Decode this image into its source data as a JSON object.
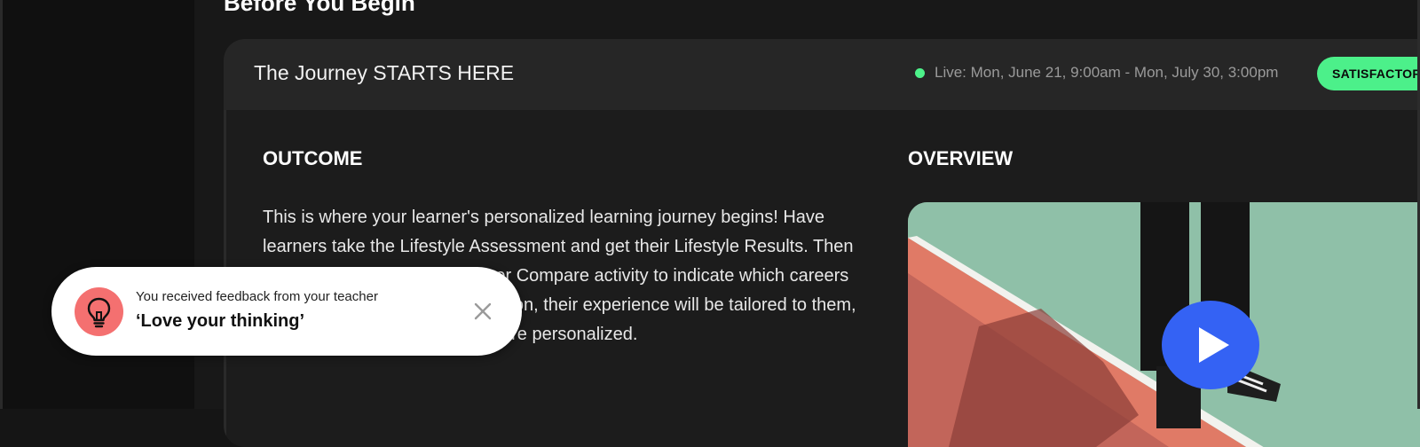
{
  "page": {
    "section_heading": "Before You Begin"
  },
  "card": {
    "title": "The Journey STARTS HERE",
    "live_text": "Live: Mon, June 21, 9:00am - Mon, July 30, 3:00pm",
    "status_badge": "SATISFACTOR"
  },
  "outcome": {
    "heading": "OUTCOME",
    "text": "This is where your learner's personalized learning journey begins! Have learners take the Lifestyle Assessment and get their Lifestyle Results. Then have them complete the Career Compare activity to indicate which careers they're interested in. From here on, their experience will be tailored to them, making it more relevant and more personalized."
  },
  "overview": {
    "heading": "OVERVIEW"
  },
  "toast": {
    "caption": "You received feedback from your teacher",
    "message": "‘Love your thinking’"
  },
  "colors": {
    "live_dot": "#4df28a",
    "badge": "#4cf08a",
    "play": "#3462f4",
    "toast_icon": "#f47070"
  },
  "icons": {
    "toast_icon": "lightbulb-icon",
    "close": "close-icon",
    "play": "play-icon"
  }
}
